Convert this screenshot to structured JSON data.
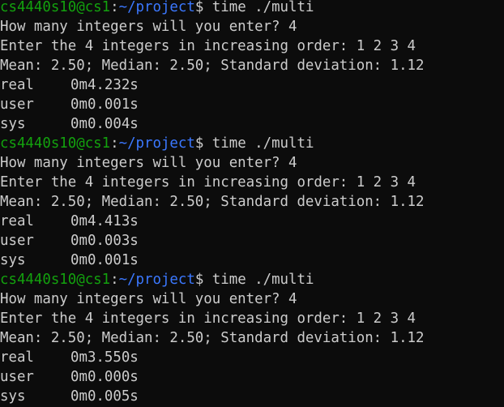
{
  "colors": {
    "background": "#0c0c0c",
    "foreground": "#cccccc",
    "prompt_user": "#13a10e",
    "prompt_path": "#3b78ff"
  },
  "runs": [
    {
      "prompt": {
        "user_host": "cs4440s10@cs1",
        "sep": ":",
        "path": "~/project",
        "symbol": "$",
        "command": " time ./multi"
      },
      "question": "How many integers will you enter? 4",
      "input_line": "Enter the 4 integers in increasing order: 1 2 3 4",
      "result": "Mean: 2.50; Median: 2.50; Standard deviation: 1.12",
      "timing": {
        "real_label": "real",
        "real_value": "0m4.232s",
        "user_label": "user",
        "user_value": "0m0.001s",
        "sys_label": "sys",
        "sys_value": "0m0.004s"
      }
    },
    {
      "prompt": {
        "user_host": "cs4440s10@cs1",
        "sep": ":",
        "path": "~/project",
        "symbol": "$",
        "command": " time ./multi"
      },
      "question": "How many integers will you enter? 4",
      "input_line": "Enter the 4 integers in increasing order: 1 2 3 4",
      "result": "Mean: 2.50; Median: 2.50; Standard deviation: 1.12",
      "timing": {
        "real_label": "real",
        "real_value": "0m4.413s",
        "user_label": "user",
        "user_value": "0m0.003s",
        "sys_label": "sys",
        "sys_value": "0m0.001s"
      }
    },
    {
      "prompt": {
        "user_host": "cs4440s10@cs1",
        "sep": ":",
        "path": "~/project",
        "symbol": "$",
        "command": " time ./multi"
      },
      "question": "How many integers will you enter? 4",
      "input_line": "Enter the 4 integers in increasing order: 1 2 3 4",
      "result": "Mean: 2.50; Median: 2.50; Standard deviation: 1.12",
      "timing": {
        "real_label": "real",
        "real_value": "0m3.550s",
        "user_label": "user",
        "user_value": "0m0.000s",
        "sys_label": "sys",
        "sys_value": "0m0.005s"
      }
    }
  ]
}
